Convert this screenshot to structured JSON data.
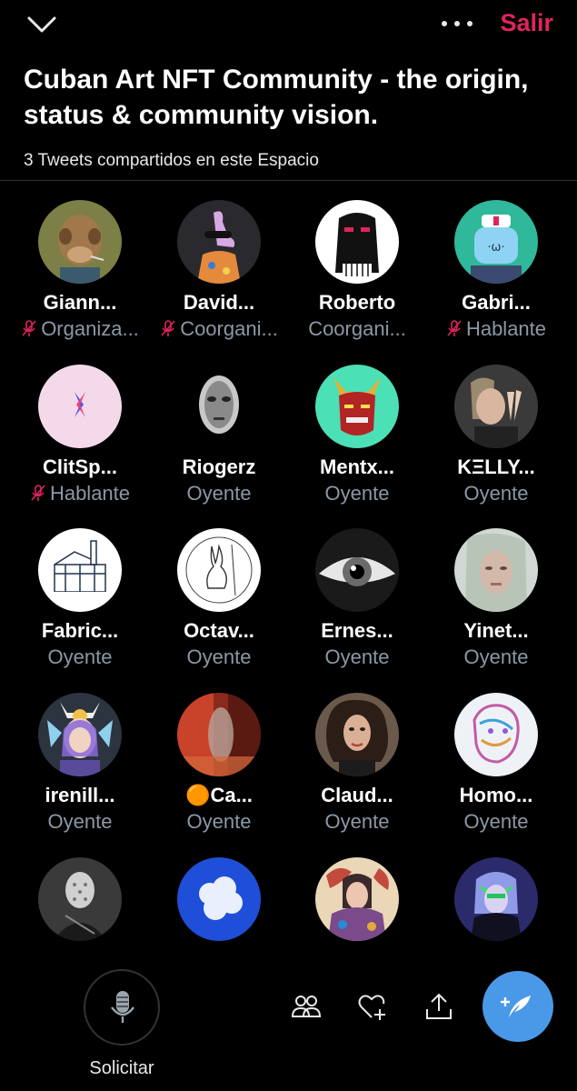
{
  "header": {
    "collapse_icon": "chevron-down-icon",
    "more_icon": "more-horizontal-icon",
    "leave_label": "Salir",
    "leave_color": "#e0245e"
  },
  "space": {
    "title": "Cuban Art NFT Community - the origin, status & community vision.",
    "tweets_shared": "3 Tweets compartidos en este Espacio"
  },
  "participants": [
    {
      "name": "Giann...",
      "role": "Organiza...",
      "muted": true
    },
    {
      "name": "David...",
      "role": "Coorgani...",
      "muted": true
    },
    {
      "name": "Roberto",
      "role": "Coorgani...",
      "muted": false
    },
    {
      "name": "Gabri...",
      "role": "Hablante",
      "muted": true
    },
    {
      "name": "ClitSp...",
      "role": "Hablante",
      "muted": true
    },
    {
      "name": "Riogerz",
      "role": "Oyente",
      "muted": false
    },
    {
      "name": "Mentx...",
      "role": "Oyente",
      "muted": false
    },
    {
      "name": "KΞLLY...",
      "role": "Oyente",
      "muted": false
    },
    {
      "name": "Fabric...",
      "role": "Oyente",
      "muted": false
    },
    {
      "name": "Octav...",
      "role": "Oyente",
      "muted": false
    },
    {
      "name": "Ernes...",
      "role": "Oyente",
      "muted": false
    },
    {
      "name": "Yinet...",
      "role": "Oyente",
      "muted": false
    },
    {
      "name": "irenill...",
      "role": "Oyente",
      "muted": false
    },
    {
      "name": "🟠Ca...",
      "role": "Oyente",
      "muted": false
    },
    {
      "name": "Claud...",
      "role": "Oyente",
      "muted": false
    },
    {
      "name": "Homo...",
      "role": "Oyente",
      "muted": false
    },
    {
      "name": "",
      "role": "",
      "muted": false
    },
    {
      "name": "",
      "role": "",
      "muted": false
    },
    {
      "name": "",
      "role": "",
      "muted": false
    },
    {
      "name": "",
      "role": "",
      "muted": false
    }
  ],
  "footer": {
    "request_label": "Solicitar",
    "request_icon": "microphone-icon",
    "people_icon": "people-icon",
    "reaction_icon": "heart-plus-icon",
    "share_icon": "share-icon",
    "compose_icon": "compose-tweet-icon",
    "compose_color": "#4a99e9"
  }
}
